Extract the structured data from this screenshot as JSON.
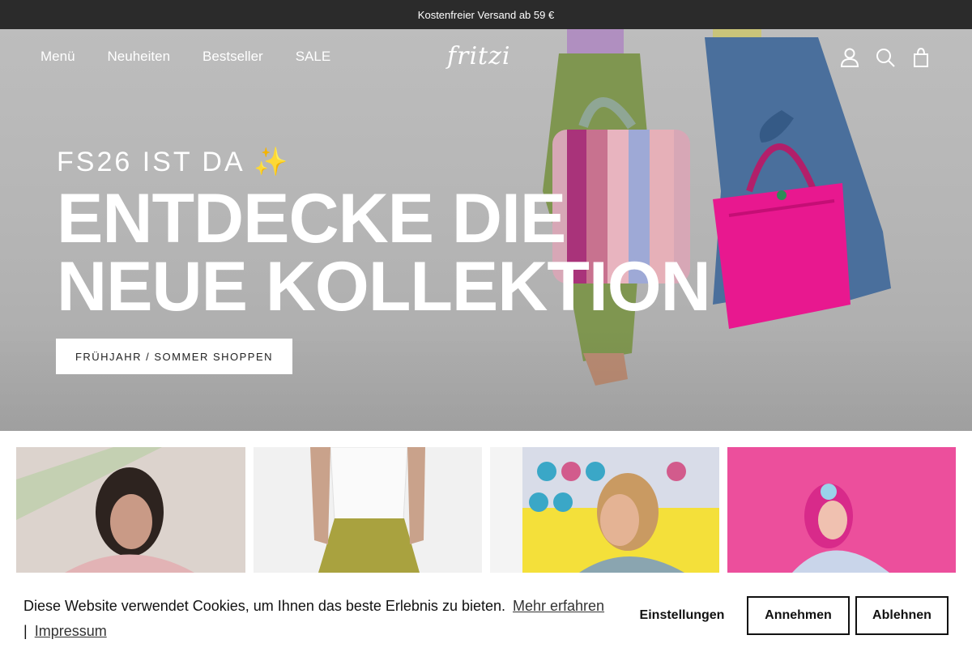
{
  "announcement": {
    "text": "Kostenfreier Versand ab 59 €"
  },
  "nav": {
    "links": [
      "Menü",
      "Neuheiten",
      "Bestseller",
      "SALE"
    ],
    "logo": "fritzi",
    "icons": [
      "account-icon",
      "search-icon",
      "cart-icon"
    ]
  },
  "hero": {
    "eyebrow": "FS26 IST DA ✨",
    "headline_line1": "ENTDECKE DIE",
    "headline_line2": "NEUE KOLLEKTION",
    "cta": "FRÜHJAHR / SOMMER SHOPPEN"
  },
  "tiles": [
    {
      "name": "category-tile-1"
    },
    {
      "name": "category-tile-2"
    },
    {
      "name": "category-tile-3"
    },
    {
      "name": "category-tile-4"
    }
  ],
  "cookie": {
    "text": "Diese Website verwendet Cookies, um Ihnen das beste Erlebnis zu bieten.",
    "more_link": "Mehr erfahren",
    "separator": "|",
    "imprint_link": "Impressum",
    "settings_label": "Einstellungen",
    "accept_label": "Annehmen",
    "decline_label": "Ablehnen"
  },
  "colors": {
    "announcement_bg": "#2b2b2b",
    "hero_bg": "#b6b6b6",
    "accent_pink": "#e8188f",
    "text_dark": "#111111"
  }
}
